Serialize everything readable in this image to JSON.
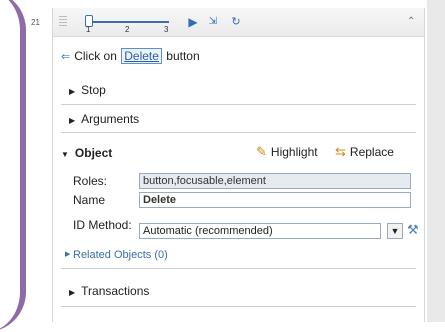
{
  "gutter": {
    "step_number": "21"
  },
  "toolbar": {
    "slider_ticks": [
      "1",
      "2",
      "3"
    ],
    "icons": [
      "play-step-icon",
      "step-into-icon",
      "step-expand-icon",
      "collapse-icon"
    ]
  },
  "step": {
    "prefix": "Click on",
    "keyword": "Delete",
    "suffix": "button"
  },
  "sections": {
    "stop": "Stop",
    "arguments": "Arguments",
    "object": "Object",
    "transactions": "Transactions"
  },
  "actions": {
    "highlight": "Highlight",
    "replace": "Replace"
  },
  "object": {
    "roles_label": "Roles:",
    "roles_value": "button,focusable,element",
    "name_label": "Name",
    "name_value": "Delete",
    "id_label": "ID Method:",
    "id_value": "Automatic (recommended)"
  },
  "related": {
    "label": "Related Objects (0)"
  }
}
